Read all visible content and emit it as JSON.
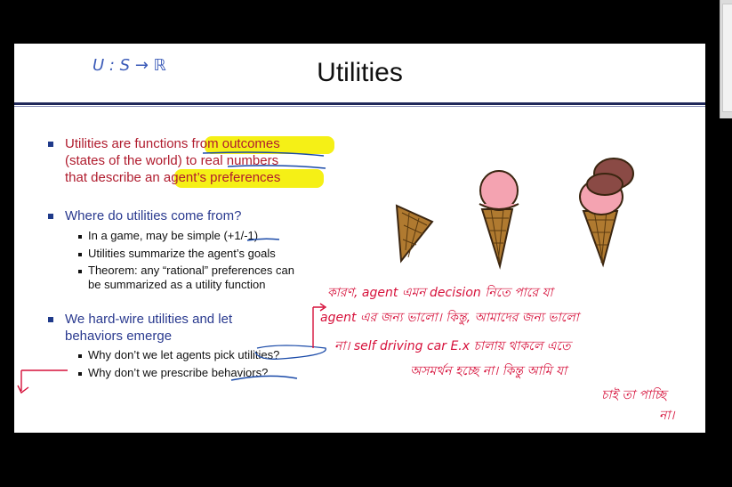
{
  "slide": {
    "title": "Utilities",
    "annotation_formula": "U : S → ℝ",
    "bullets": [
      {
        "lines": [
          "Utilities are functions from outcomes",
          "(states of the world) to real numbers",
          "that describe an agent’s preferences"
        ]
      },
      {
        "heading": "Where do utilities come from?",
        "subs": [
          "In a game, may be simple (+1/-1)",
          "Utilities summarize the agent’s goals",
          "Theorem: any “rational” preferences can",
          "be summarized as a utility function"
        ]
      },
      {
        "heading_lines": [
          "We hard-wire utilities and let",
          "behaviors emerge"
        ],
        "subs": [
          "Why don’t we let agents pick utilities?",
          "Why don’t we prescribe behaviors?"
        ]
      }
    ],
    "handwriting": [
      "কারণ, agent এমন decision নিতে পারে যা",
      "agent এর জন্য ভালো। কিন্তু, আমাদের জন্য ভালো",
      "না। self driving car E.x চালায় থাকলে এতে",
      "অসমর্থন হচ্ছে না। কিন্তু আমি যা",
      "চাই তা পাচ্ছি",
      "না।"
    ]
  },
  "colors": {
    "accent_red": "#b01c2e",
    "accent_blue": "#2a3a8f",
    "highlight": "#f5f016",
    "ink": "#d6103a"
  }
}
